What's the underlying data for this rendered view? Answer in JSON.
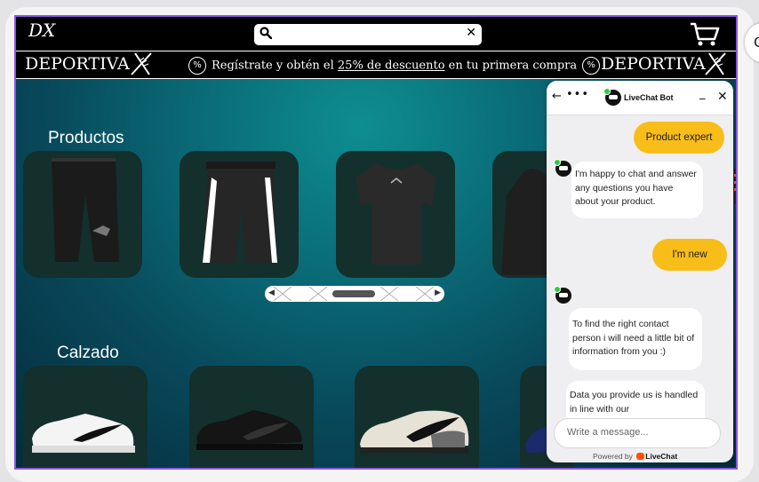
{
  "header": {
    "logo_text": "DX",
    "search": {
      "value": "",
      "placeholder": ""
    },
    "banner": {
      "brand": "DEPORTIVA",
      "promo_before": "Regístrate y obtén el ",
      "promo_link": "25% de descuento",
      "promo_after": " en tu primera compra",
      "badge": "%"
    }
  },
  "sections": [
    {
      "title": "Productos",
      "items": [
        "pants",
        "shorts",
        "tshirt",
        "hoodie"
      ]
    },
    {
      "title": "Calzado",
      "items": [
        "white-sneaker",
        "black-sneaker",
        "cream-sneaker",
        "blue-sneaker"
      ]
    }
  ],
  "chat": {
    "title": "LiveChat Bot",
    "messages": [
      {
        "from": "user",
        "text": "Product expert"
      },
      {
        "from": "bot",
        "text": "I'm happy to chat and answer any questions you have about your product."
      },
      {
        "from": "user",
        "text": "I'm new"
      },
      {
        "from": "bot",
        "text": "To find the right contact person i will need a little bit of information from you :)"
      },
      {
        "from": "bot",
        "text": "Data you provide us is handled in line with our"
      }
    ],
    "input_placeholder": "Write a message...",
    "powered_by": "Powered by",
    "powered_brand": "LiveChat"
  },
  "colors": {
    "accent": "#f9bd1a",
    "frame": "#8b55e0",
    "teal": "#0a6c78",
    "card": "#13302d"
  }
}
